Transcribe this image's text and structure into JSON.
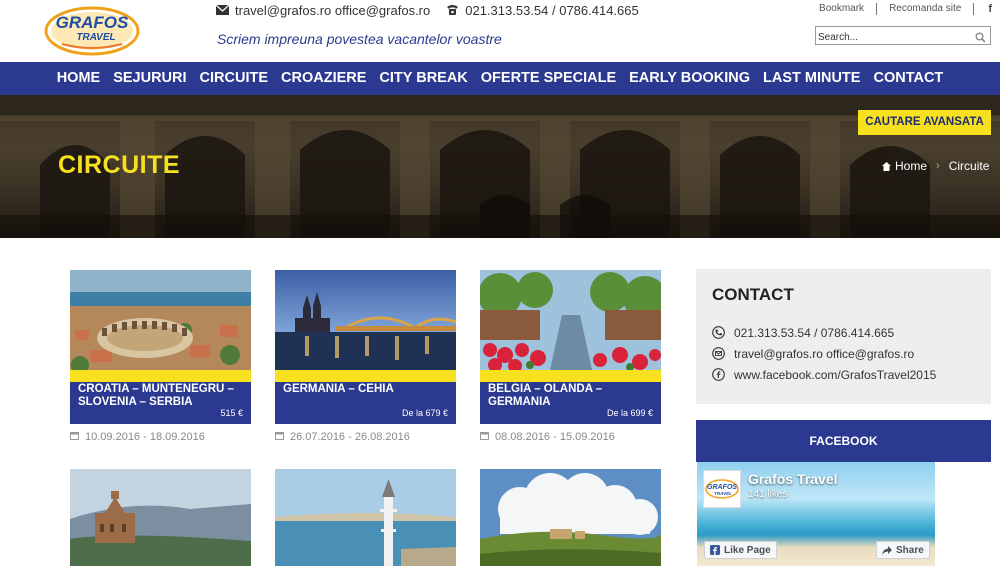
{
  "header": {
    "logo_text_top": "GRAFOS",
    "logo_text_bottom": "TRAVEL",
    "emails": "travel@grafos.ro office@grafos.ro",
    "phones": "021.313.53.54 / 0786.414.665",
    "slogan": "Scriem impreuna povestea vacantelor voastre",
    "links": [
      "Bookmark",
      "Recomanda site"
    ],
    "facebook_letter": "f",
    "search_placeholder": "Search..."
  },
  "nav": [
    "HOME",
    "SEJURURI",
    "CIRCUITE",
    "CROAZIERE",
    "CITY BREAK",
    "OFERTE SPECIALE",
    "EARLY BOOKING",
    "LAST MINUTE",
    "CONTACT"
  ],
  "hero": {
    "title": "CIRCUITE",
    "advanced_search": "CAUTARE AVANSATA",
    "breadcrumb": [
      "Home",
      "Circuite"
    ]
  },
  "cards": [
    {
      "name": "CROATIA – MUNTENEGRU – SLOVENIA – SERBIA",
      "price": "515 €",
      "dates": "10.09.2016 - 18.09.2016"
    },
    {
      "name": "GERMANIA – CEHIA",
      "price": "De la 679 €",
      "dates": "26.07.2016 - 26.08.2016"
    },
    {
      "name": "BELGIA – OLANDA – GERMANIA",
      "price": "De la 699 €",
      "dates": "08.08.2016 - 15.09.2016"
    }
  ],
  "sidebar": {
    "contact_title": "CONTACT",
    "phone": "021.313.53.54 / 0786.414.665",
    "email": "travel@grafos.ro office@grafos.ro",
    "facebook_url": "www.facebook.com/GrafosTravel2015",
    "facebook_title": "FACEBOOK",
    "fb_page_name": "Grafos Travel",
    "fb_likes": "141 likes",
    "fb_like_button": "Like Page",
    "fb_share_button": "Share"
  },
  "colors": {
    "brand_blue": "#2b3990",
    "accent_yellow": "#f7e11e"
  }
}
